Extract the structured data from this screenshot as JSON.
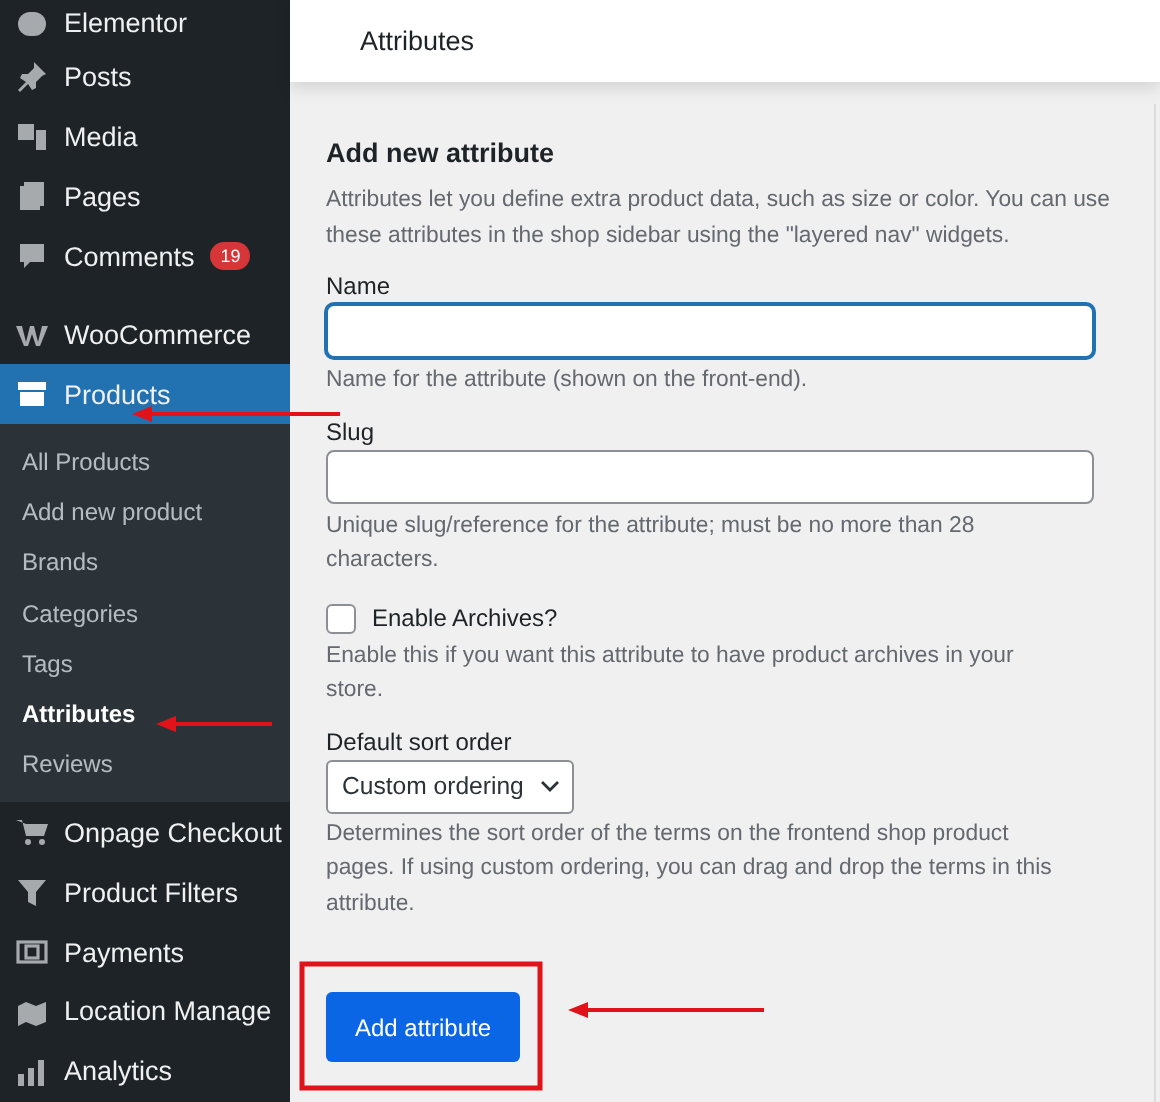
{
  "sidebar": {
    "items": [
      {
        "label": "Elementor",
        "kind": "top",
        "selected": false
      },
      {
        "label": "Posts",
        "kind": "top",
        "selected": false
      },
      {
        "label": "Media",
        "kind": "top",
        "selected": false
      },
      {
        "label": "Pages",
        "kind": "top",
        "selected": false
      },
      {
        "label": "Comments",
        "kind": "top",
        "selected": false,
        "badge": "19"
      },
      {
        "label": "WooCommerce",
        "kind": "top",
        "selected": false,
        "gap": true
      },
      {
        "label": "Products",
        "kind": "top",
        "selected": true,
        "children": [
          {
            "label": "All Products",
            "selected": false
          },
          {
            "label": "Add new product",
            "selected": false
          },
          {
            "label": "Brands",
            "selected": false
          },
          {
            "label": "Categories",
            "selected": false
          },
          {
            "label": "Tags",
            "selected": false
          },
          {
            "label": "Attributes",
            "selected": true
          },
          {
            "label": "Reviews",
            "selected": false
          }
        ]
      },
      {
        "label": "Onpage Checkout",
        "kind": "top",
        "selected": false
      },
      {
        "label": "Product Filters",
        "kind": "top",
        "selected": false
      },
      {
        "label": "Payments",
        "kind": "top",
        "selected": false
      },
      {
        "label": "Location Manage",
        "kind": "top",
        "selected": false
      },
      {
        "label": "Analytics",
        "kind": "top",
        "selected": false
      }
    ]
  },
  "header": {
    "title": "Attributes"
  },
  "form": {
    "heading": "Add new attribute",
    "intro": "Attributes let you define extra product data, such as size or color. You can use these attributes in the shop sidebar using the \"layered nav\" widgets.",
    "fields": [
      {
        "kind": "text",
        "label": "Name",
        "focused": true,
        "help": "Name for the attribute (shown on the front-end)."
      },
      {
        "kind": "text",
        "label": "Slug",
        "focused": false,
        "help": "Unique slug/reference for the attribute; must be no more than 28 characters."
      },
      {
        "kind": "checkbox",
        "label": "Enable Archives?",
        "checked": false,
        "help": "Enable this if you want this attribute to have product archives in your store."
      },
      {
        "kind": "select",
        "label": "Default sort order",
        "value": "Custom ordering",
        "help": "Determines the sort order of the terms on the frontend shop product pages. If using custom ordering, you can drag and drop the terms in this attribute."
      }
    ],
    "submit": "Add attribute"
  }
}
